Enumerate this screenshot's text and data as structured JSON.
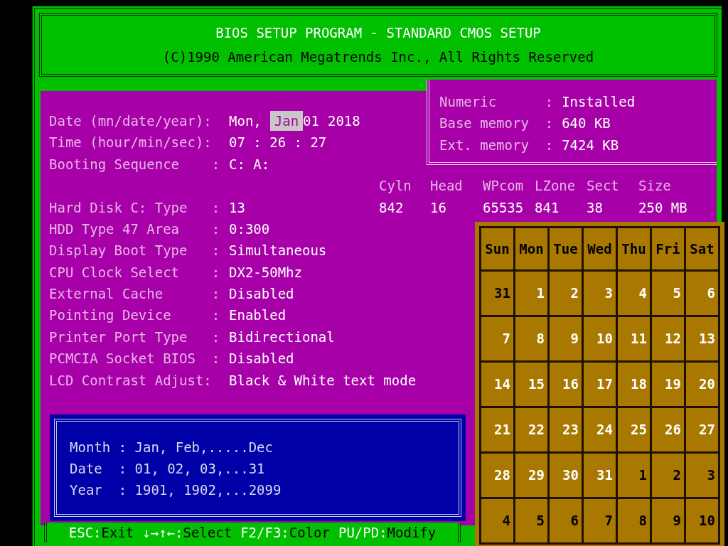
{
  "header": {
    "title": "BIOS SETUP PROGRAM - STANDARD CMOS SETUP",
    "copyright": "(C)1990 American Megatrends Inc., All Rights Reserved"
  },
  "date": {
    "label": "Date (mn/date/year):",
    "parts": [
      {
        "text": "Mon,",
        "selected": false
      },
      {
        "text": "Jan",
        "selected": true
      },
      {
        "text": "01",
        "selected": false
      },
      {
        "text": "2018",
        "selected": false
      }
    ]
  },
  "top_settings": [
    {
      "label": "Time (hour/min/sec):",
      "value": "07 : 26 : 27"
    },
    {
      "label": "Booting Sequence    :",
      "value": "C: A:"
    }
  ],
  "info": [
    {
      "label": "Numeric      :",
      "value": "Installed"
    },
    {
      "label": "Base memory  :",
      "value": "640 KB"
    },
    {
      "label": "Ext. memory  :",
      "value": "7424 KB"
    }
  ],
  "hard_disk": {
    "label": "Hard Disk C: Type   :",
    "value": "13",
    "columns": [
      {
        "header": "Cyln",
        "value": "842"
      },
      {
        "header": "Head",
        "value": "16"
      },
      {
        "header": "WPcom",
        "value": "65535"
      },
      {
        "header": "LZone",
        "value": "841"
      },
      {
        "header": "Sect",
        "value": "38"
      },
      {
        "header": "Size",
        "value": "250 MB"
      }
    ]
  },
  "settings": [
    {
      "label": "HDD Type 47 Area    :",
      "value": "0:300"
    },
    {
      "label": "Display Boot Type   :",
      "value": "Simultaneous"
    },
    {
      "label": "CPU Clock Select    :",
      "value": "DX2-50Mhz"
    },
    {
      "label": "External Cache      :",
      "value": "Disabled"
    },
    {
      "label": "Pointing Device     :",
      "value": "Enabled"
    },
    {
      "label": "Printer Port Type   :",
      "value": "Bidirectional"
    },
    {
      "label": "PCMCIA Socket BIOS  :",
      "value": "Disabled"
    },
    {
      "label": "LCD Contrast Adjust:",
      "value": "Black & White text mode"
    }
  ],
  "help": [
    "Month : Jan, Feb,.....Dec",
    "Date  : 01, 02, 03,...31",
    "Year  : 1901, 1902,...2099"
  ],
  "footer": [
    {
      "key": "ESC:",
      "action": "Exit"
    },
    {
      "key": "↓→↑←:",
      "action": "Select"
    },
    {
      "key": "F2/F3:",
      "action": "Color"
    },
    {
      "key": "PU/PD:",
      "action": "Modify"
    }
  ],
  "calendar": {
    "weekdays": [
      "Sun",
      "Mon",
      "Tue",
      "Wed",
      "Thu",
      "Fri",
      "Sat"
    ],
    "days": [
      {
        "text": "31",
        "in_month": false
      },
      {
        "text": "1",
        "in_month": true
      },
      {
        "text": "2",
        "in_month": true
      },
      {
        "text": "3",
        "in_month": true
      },
      {
        "text": "4",
        "in_month": true
      },
      {
        "text": "5",
        "in_month": true
      },
      {
        "text": "6",
        "in_month": true
      },
      {
        "text": "7",
        "in_month": true
      },
      {
        "text": "8",
        "in_month": true
      },
      {
        "text": "9",
        "in_month": true
      },
      {
        "text": "10",
        "in_month": true
      },
      {
        "text": "11",
        "in_month": true
      },
      {
        "text": "12",
        "in_month": true
      },
      {
        "text": "13",
        "in_month": true
      },
      {
        "text": "14",
        "in_month": true
      },
      {
        "text": "15",
        "in_month": true
      },
      {
        "text": "16",
        "in_month": true
      },
      {
        "text": "17",
        "in_month": true
      },
      {
        "text": "18",
        "in_month": true
      },
      {
        "text": "19",
        "in_month": true
      },
      {
        "text": "20",
        "in_month": true
      },
      {
        "text": "21",
        "in_month": true
      },
      {
        "text": "22",
        "in_month": true
      },
      {
        "text": "23",
        "in_month": true
      },
      {
        "text": "24",
        "in_month": true
      },
      {
        "text": "25",
        "in_month": true
      },
      {
        "text": "26",
        "in_month": true
      },
      {
        "text": "27",
        "in_month": true
      },
      {
        "text": "28",
        "in_month": true
      },
      {
        "text": "29",
        "in_month": true
      },
      {
        "text": "30",
        "in_month": true
      },
      {
        "text": "31",
        "in_month": true
      },
      {
        "text": "1",
        "in_month": false
      },
      {
        "text": "2",
        "in_month": false
      },
      {
        "text": "3",
        "in_month": false
      },
      {
        "text": "4",
        "in_month": false
      },
      {
        "text": "5",
        "in_month": false
      },
      {
        "text": "6",
        "in_month": false
      },
      {
        "text": "7",
        "in_month": false
      },
      {
        "text": "8",
        "in_month": false
      },
      {
        "text": "9",
        "in_month": false
      },
      {
        "text": "10",
        "in_month": false
      }
    ]
  }
}
